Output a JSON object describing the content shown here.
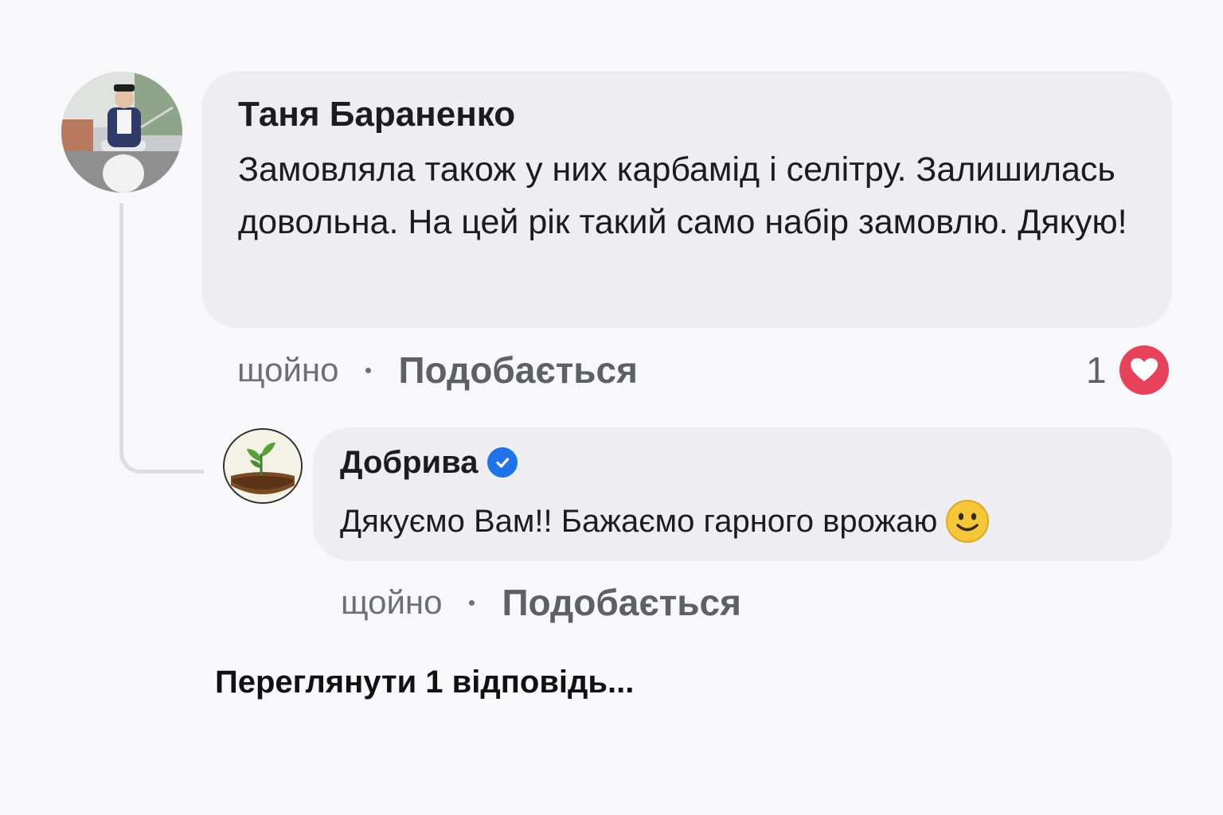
{
  "comment": {
    "author": "Таня Бараненко",
    "text": "Замовляла також у них карбамід і селітру. Залишилась довольна. На цей рік такий само набір замовлю. Дякую!",
    "time": "щойно",
    "like_label": "Подобається",
    "reaction_count": "1",
    "reaction_icon": "heart-icon",
    "reaction_color": "#e8415a"
  },
  "reply": {
    "author": "Добрива",
    "verified": true,
    "verified_color": "#1f73e8",
    "text": "Дякуємо Вам!! Бажаємо гарного врожаю",
    "emoji": "smiling-face-icon",
    "time": "щойно",
    "like_label": "Подобається"
  },
  "view_replies_label": "Переглянути 1 відповідь..."
}
